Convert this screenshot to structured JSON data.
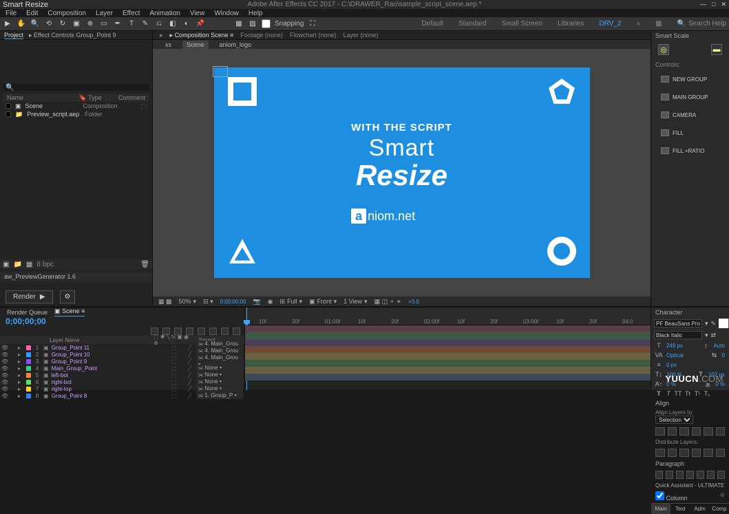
{
  "titlebar": {
    "title": "Smart Resize",
    "doc": "Adobe After Effects CC 2017 - C:\\DRAWER_Rao\\sample_script_scene.aep *"
  },
  "menu": [
    "File",
    "Edit",
    "Composition",
    "Layer",
    "Effect",
    "Animation",
    "View",
    "Window",
    "Help"
  ],
  "toolbar": {
    "snapping": "Snapping",
    "workspaces": [
      "Default",
      "Standard",
      "Small Screen",
      "Libraries"
    ],
    "active_ws": "DRV_2",
    "search": "Search Help"
  },
  "project": {
    "tabs": [
      "Project",
      "Effect Controls Group_Point 9"
    ],
    "headers": [
      "Name",
      "Type",
      "Comment"
    ],
    "items": [
      {
        "name": "Scene",
        "type": "Composition"
      },
      {
        "name": "Preview_script.aep",
        "type": "Folder"
      }
    ],
    "bpc": "8 bpc",
    "preview_gen": "aw_PreviewGenerator 1.6",
    "render": "Render"
  },
  "comp": {
    "tabs": [
      "Composition Scene",
      "Footage (none)",
      "Flowchart (none)",
      "Layer (none)"
    ],
    "subtabs": [
      "xs",
      "Scene",
      "aniom_logo"
    ],
    "canvas": {
      "line1": "WITH THE SCRIPT",
      "line2": "Smart",
      "line3": "Resize",
      "logo": "niom.net",
      "logo_letter": "a"
    },
    "footer": {
      "zoom": "50%",
      "time": "0;00;00;00",
      "res": "Full",
      "view": "Front",
      "views": "1 View",
      "rot": "+0.0"
    }
  },
  "smart_scale": {
    "title": "Smart Scale",
    "controls": "Controls:",
    "buttons": [
      "NEW GROUP",
      "MAIN GROUP",
      "CAMERA",
      "FILL",
      "FILL +RATIO"
    ]
  },
  "char": {
    "title": "Character",
    "font": "PF BeauSans Pro",
    "style": "Black Italic",
    "size": "249 px",
    "leading": "Auto",
    "kerning": "Optical",
    "tracking": "0",
    "vscale": "100 %",
    "hscale": "102 px",
    "baseline": "0 px",
    "tsume": "0 %",
    "align_title": "Align",
    "align_to": "Align Layers to:",
    "align_sel": "Selection",
    "dist": "Distribute Layers:",
    "para": "Paragraph",
    "qa": "Quick Assistant - ULTIMATE",
    "qa_col": "Column",
    "qa_tabs": [
      "Main",
      "Text",
      "Adm",
      "Comp"
    ]
  },
  "timeline": {
    "tabs": [
      "Render Queue",
      "Scene"
    ],
    "time": "0;00;00;00",
    "col_layer": "Layer Name",
    "col_parent": "Parent",
    "ticks": [
      "10f",
      "20f",
      "01:00f",
      "10f",
      "20f",
      "02:00f",
      "10f",
      "20f",
      "03:00f",
      "10f",
      "20f",
      "04:0"
    ],
    "layers": [
      {
        "n": "1",
        "name": "Group_Point 11",
        "parent": "4. Main_Grou",
        "c": "#ff60b0",
        "bar": "#5a3f4a"
      },
      {
        "n": "2",
        "name": "Group_Point 10",
        "parent": "4. Main_Grou",
        "c": "#30a0ff",
        "bar": "#3a5a44"
      },
      {
        "n": "3",
        "name": "Group_Point 9",
        "parent": "4. Main_Grou",
        "c": "#8a50ff",
        "bar": "#4a3f5a"
      },
      {
        "n": "4",
        "name": "Main_Group_Point",
        "parent": "None",
        "c": "#30d080",
        "bar": "#724a3a"
      },
      {
        "n": "5",
        "name": "left-bot",
        "parent": "None",
        "c": "#ff8030",
        "bar": "#6a6040"
      },
      {
        "n": "6",
        "name": "right-bot",
        "parent": "None",
        "c": "#60e060",
        "bar": "#3a5a44"
      },
      {
        "n": "7",
        "name": "right-top",
        "parent": "None",
        "c": "#ffd030",
        "bar": "#6a6040"
      },
      {
        "n": "8",
        "name": "Group_Point 8",
        "parent": "1. Group_P",
        "c": "#3080ff",
        "bar": "#3a4a5a"
      }
    ]
  },
  "watermark": "YUUCN.COM"
}
